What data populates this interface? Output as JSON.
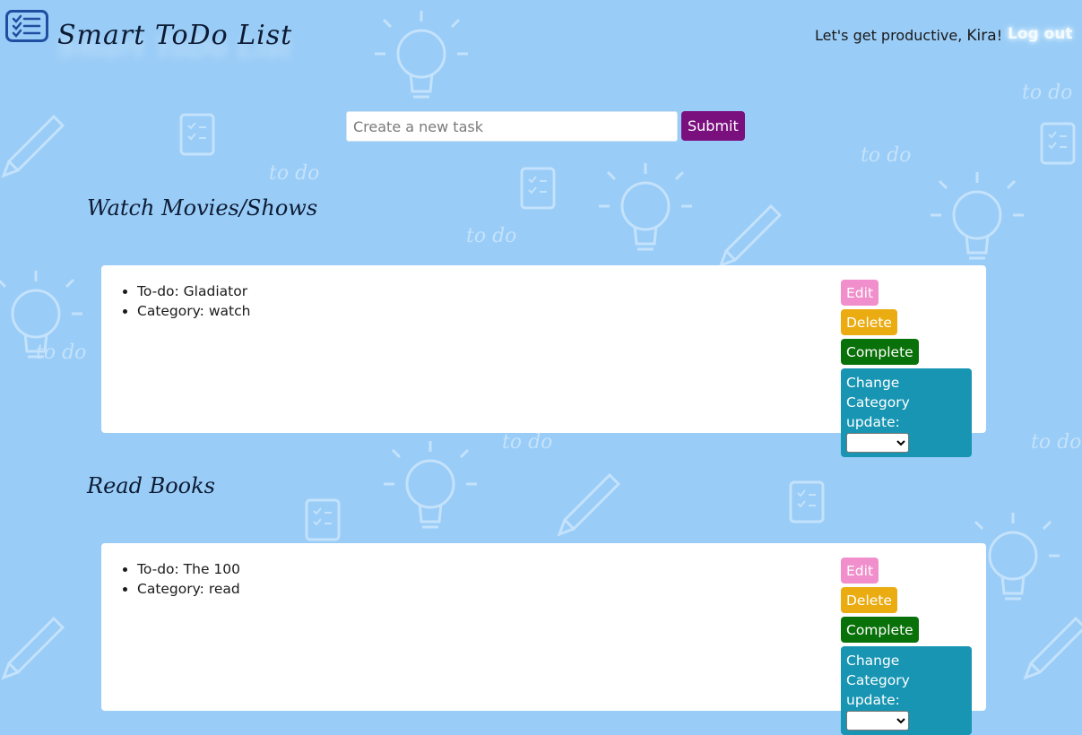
{
  "header": {
    "brand": "Smart ToDo List",
    "greeting_prefix": "Let's get productive, ",
    "username": "Kira",
    "greeting_suffix": "!",
    "logout_label": "Log out"
  },
  "new_task": {
    "placeholder": "Create a new task",
    "submit_label": "Submit"
  },
  "categories": [
    {
      "heading": "Watch Movies/Shows",
      "task": {
        "todo": "To-do: Gladiator",
        "category": "Category: watch",
        "edit_label": "Edit",
        "delete_label": "Delete",
        "complete_label": "Complete",
        "change_label": "Change Category",
        "update_label": "update:",
        "selected_option": ""
      }
    },
    {
      "heading": "Read Books",
      "task": {
        "todo": "To-do: The 100",
        "category": "Category: read",
        "edit_label": "Edit",
        "delete_label": "Delete",
        "complete_label": "Complete",
        "change_label": "Change Category",
        "update_label": "update:",
        "selected_option": ""
      }
    }
  ],
  "colors": {
    "background": "#99ccf7",
    "submit": "#7a0f7e",
    "edit": "#f08fcb",
    "delete": "#ebac12",
    "complete": "#097109",
    "change_category": "#1795b3"
  }
}
